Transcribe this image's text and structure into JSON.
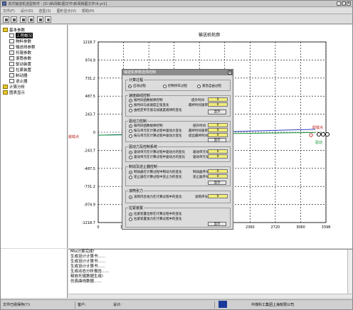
{
  "window": {
    "title": "流式输送机选型软件 - [D:\\新闻稿\\图文件\\新闻稿图文件\\9.yr1]"
  },
  "menu": [
    "文件(F)",
    "设计(D)",
    "选型(S)",
    "图形显示(V)",
    "帮助(H)"
  ],
  "tree": [
    {
      "label": "基本参数",
      "level": 0,
      "icon": "folder-icon"
    },
    {
      "label": "工程概况",
      "level": 1,
      "icon": "doc-icon"
    },
    {
      "label": "物料参数",
      "level": 1,
      "icon": "doc-icon"
    },
    {
      "label": "输送线参数",
      "level": 1,
      "icon": "doc-icon"
    },
    {
      "label": "托辊参数",
      "level": 1,
      "icon": "doc-icon"
    },
    {
      "label": "滚筒参数",
      "level": 1,
      "icon": "doc-icon"
    },
    {
      "label": "驱动装置",
      "level": 1,
      "icon": "doc-icon"
    },
    {
      "label": "拉紧装置",
      "level": 1,
      "icon": "doc-icon"
    },
    {
      "label": "制动器",
      "level": 1,
      "icon": "doc-icon"
    },
    {
      "label": "逆止器",
      "level": 1,
      "icon": "doc-icon"
    },
    {
      "label": "计算分析",
      "level": 0,
      "icon": "folder-icon"
    },
    {
      "label": "图表显示",
      "level": 0,
      "icon": "folder-icon"
    }
  ],
  "chart_data": {
    "type": "line",
    "title": "输送机轮廓",
    "x_ticks": [
      "0",
      "360",
      "800",
      "1200",
      "1600",
      "2000",
      "2360",
      "2720",
      "3080",
      "3398"
    ],
    "y_ticks": [
      "1218.7",
      "974.9",
      "731.2",
      "487.5",
      "243.7",
      "0",
      "-243.7",
      "-487.5",
      "-731.2",
      "-974.9",
      "-1218.7"
    ],
    "ylim": [
      -1218.7,
      1218.7
    ],
    "series": [
      {
        "x": [
          0,
          3240
        ],
        "y": [
          -40,
          40
        ],
        "color": "#2a3ec0"
      },
      {
        "x": [
          0,
          3240
        ],
        "y": [
          -40,
          -4
        ],
        "color": "#1a9a3a"
      }
    ],
    "annotations": {
      "head_label": "卸载点",
      "tail_label": "装载点",
      "green_label": "驱动"
    }
  },
  "dialog": {
    "title": "输送机参数选择控制",
    "groups": {
      "calc": {
        "title": "计算过程",
        "opts": [
          "启动过程",
          "控制停车过程",
          "紧急自由过程"
        ]
      },
      "speed": {
        "title": "速度曲线控制",
        "opts": [
          "按时间函数规律控制",
          "按时间与加速度正弦变化",
          "由给定单元值与加速度规律的变化"
        ],
        "fields": [
          "提升时间",
          "最终时间速率"
        ],
        "values": [
          "0",
          "0"
        ],
        "button": "显示"
      },
      "drive": {
        "title": "驱动力控制",
        "opts": [
          "按时间函数规律控制",
          "按与单元在计算过程中驱动力变化",
          "按与单元在计算过程中驱动力变化"
        ],
        "fields": [
          "提升时间",
          "最终时间速率",
          "提出最终时间"
        ],
        "values": [
          "0",
          "0",
          "0"
        ],
        "button": "显示"
      },
      "brake_drive": {
        "title": "驱动力及控制系统",
        "opts": [
          "驱动单元在计算过程中驱动力的变化",
          "驱动单元在计算过程中驱动力的变化"
        ],
        "fields": [
          "驱动单元号",
          "驱动单元号"
        ],
        "values": [
          "0",
          "0"
        ],
        "button": "显示"
      },
      "braking": {
        "title": "制动及逆止器控制",
        "opts": [
          "制动器在计算过程中制动力的变化",
          "逆止器在计算过程中逆止力的变化"
        ],
        "fields": [
          "制动器序号",
          "逆止器序号"
        ],
        "values": [
          "0",
          "0"
        ],
        "button": "显示"
      },
      "roller": {
        "title": "滚筒张力",
        "opts": [
          "滚筒内合张力在计算过程中的变化"
        ],
        "fields": [
          "滚筒序号"
        ],
        "values": [
          "0"
        ],
        "button": "显示"
      },
      "belt": {
        "title": "拉紧装置",
        "opts": [
          "拉紧装置位移在计算过程中的变化",
          "拉紧装置张力在计算过程中的变化"
        ],
        "button": "显示"
      }
    }
  },
  "output": {
    "lines": [
      "Mix计算完成!",
      "生成设计计算书......",
      "生成设计计算书......",
      "生成设计计算书......",
      "生成动态分析报告......",
      "释放托辊数据生成!",
      "仿真曲线数据......"
    ]
  },
  "status": {
    "left": "文件已经保存(!!)",
    "user_label": "客户:",
    "designer_label": "设计:",
    "company": "中煤科工集团上海有限公司"
  }
}
